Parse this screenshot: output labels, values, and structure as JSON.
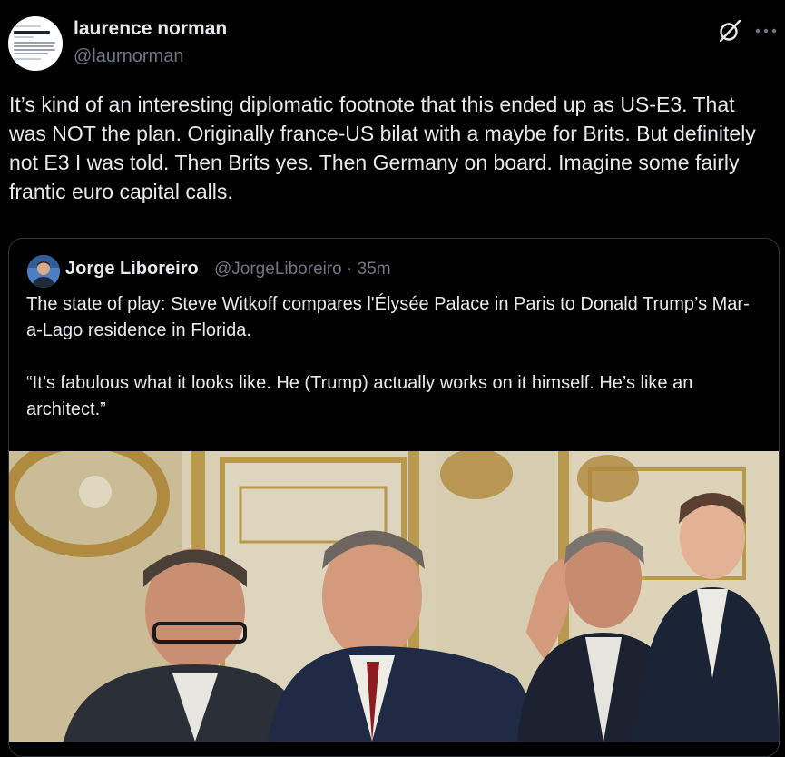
{
  "tweet": {
    "author": {
      "display_name": "laurence norman",
      "handle": "@laurnorman"
    },
    "header_icons": [
      "grok-icon",
      "more-icon"
    ],
    "text": "It’s kind of an interesting diplomatic footnote that this ended up as US-E3. That was NOT the plan. Originally france-US bilat with a maybe for Brits. But definitely not E3 I was told. Then Brits yes. Then Germany on board. Imagine some fairly frantic euro capital calls."
  },
  "quoted": {
    "author": {
      "display_name": "Jorge Liboreiro",
      "handle_time": "@JorgeLiboreiro · 35m"
    },
    "paragraphs": [
      "The state of play: Steve Witkoff compares l'Élysée Palace in Paris to Donald Trump’s Mar-a-Lago residence in Florida.",
      "“It’s fabulous what it looks like. He (Trump) actually works on it himself. He’s like an architect.”"
    ]
  },
  "colors": {
    "background": "#000000",
    "text_primary": "#e7e9ea",
    "text_secondary": "#71767b",
    "border": "#2f3336"
  }
}
